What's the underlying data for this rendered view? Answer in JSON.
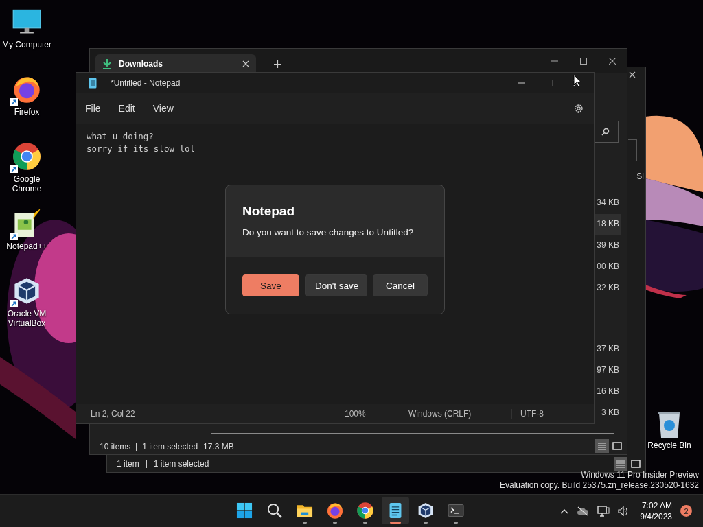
{
  "desktop_icons": [
    {
      "label": "My Computer",
      "kind": "monitor",
      "shortcut": false
    },
    {
      "label": "Firefox",
      "kind": "firefox",
      "shortcut": true
    },
    {
      "label": "Google Chrome",
      "kind": "chrome",
      "shortcut": true
    },
    {
      "label": "Notepad++",
      "kind": "notepadpp",
      "shortcut": true
    },
    {
      "label": "Oracle VM VirtualBox",
      "kind": "virtualbox",
      "shortcut": true
    }
  ],
  "recycle_bin": {
    "label": "Recycle Bin"
  },
  "explorer_back": {
    "column_header": "Si",
    "status_items": [
      "1 item",
      "1 item selected"
    ]
  },
  "explorer": {
    "tab": {
      "label": "Downloads"
    },
    "size_groups": [
      [
        {
          "text": "34 KB",
          "selected": false
        },
        {
          "text": "18 KB",
          "selected": true
        },
        {
          "text": "39 KB",
          "selected": false
        },
        {
          "text": "00 KB",
          "selected": false
        },
        {
          "text": "32 KB",
          "selected": false
        }
      ],
      [
        {
          "text": "37 KB",
          "selected": false
        },
        {
          "text": "97 KB",
          "selected": false
        },
        {
          "text": "16 KB",
          "selected": false
        },
        {
          "text": "3 KB",
          "selected": false
        }
      ]
    ],
    "status_items": [
      "10 items",
      "1 item selected",
      "17.3 MB"
    ]
  },
  "notepad": {
    "title": "*Untitled - Notepad",
    "menu": [
      "File",
      "Edit",
      "View"
    ],
    "lines": [
      "what u doing?",
      "sorry if its slow lol"
    ],
    "status": {
      "position": "Ln 2, Col 22",
      "zoom": "100%",
      "line_ending": "Windows (CRLF)",
      "encoding": "UTF-8"
    }
  },
  "dialog": {
    "title": "Notepad",
    "message": "Do you want to save changes to Untitled?",
    "buttons": [
      {
        "label": "Save",
        "kind": "primary"
      },
      {
        "label": "Don't save",
        "kind": "secondary"
      },
      {
        "label": "Cancel",
        "kind": "secondary"
      }
    ]
  },
  "watermark_lines": [
    "Windows 11 Pro Insider Preview",
    "Evaluation copy. Build 25375.zn_release.230520-1632"
  ],
  "taskbar": {
    "apps": [
      {
        "kind": "start",
        "running": false,
        "selected": false
      },
      {
        "kind": "search",
        "running": false,
        "selected": false
      },
      {
        "kind": "explorer",
        "running": true,
        "selected": false
      },
      {
        "kind": "firefox",
        "running": true,
        "selected": false
      },
      {
        "kind": "chrome",
        "running": true,
        "selected": false
      },
      {
        "kind": "notepad",
        "running": true,
        "selected": true
      },
      {
        "kind": "virtualbox",
        "running": true,
        "selected": false
      },
      {
        "kind": "terminal",
        "running": true,
        "selected": false
      }
    ],
    "time": "7:02 AM",
    "date": "9/4/2023",
    "notification_count": "2"
  }
}
